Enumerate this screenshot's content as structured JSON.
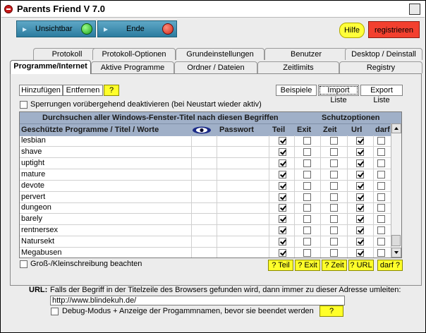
{
  "window": {
    "title": "Parents Friend V 7.0"
  },
  "topbar": {
    "unsichtbar": "Unsichtbar",
    "ende": "Ende",
    "hilfe": "Hilfe",
    "registrieren": "registrieren"
  },
  "tabs_row1": [
    "Protokoll",
    "Protokoll-Optionen",
    "Grundeinstellungen",
    "Benutzer",
    "Desktop / Deinstall"
  ],
  "tabs_row2": [
    "Programme/Internet",
    "Aktive Programme",
    "Ordner / Dateien",
    "Zeitlimits",
    "Registry"
  ],
  "toolbar": {
    "add": "Hinzufügen",
    "remove": "Entfernen",
    "help": "?",
    "examples": "Beispiele",
    "import": "Import Liste",
    "export": "Export Liste"
  },
  "deactivate_label": "Sperrungen vorübergehend deaktivieren (bei Neustart wieder aktiv)",
  "grid": {
    "header_search": "Durchsuchen aller Windows-Fenster-Titel nach diesen Begriffen",
    "header_protect": "Schutzoptionen",
    "columns": [
      "Geschützte Programme / Titel / Worte",
      "Passwort",
      "Teil",
      "Exit",
      "Zeit",
      "Url",
      "darf"
    ],
    "rows": [
      {
        "name": "lesbian",
        "teil": true,
        "exit": false,
        "zeit": false,
        "url": true,
        "darf": false
      },
      {
        "name": "shave",
        "teil": true,
        "exit": false,
        "zeit": false,
        "url": true,
        "darf": false
      },
      {
        "name": "uptight",
        "teil": true,
        "exit": false,
        "zeit": false,
        "url": true,
        "darf": false
      },
      {
        "name": "mature",
        "teil": true,
        "exit": false,
        "zeit": false,
        "url": true,
        "darf": false
      },
      {
        "name": "devote",
        "teil": true,
        "exit": false,
        "zeit": false,
        "url": true,
        "darf": false
      },
      {
        "name": "pervert",
        "teil": true,
        "exit": false,
        "zeit": false,
        "url": true,
        "darf": false
      },
      {
        "name": "dungeon",
        "teil": true,
        "exit": false,
        "zeit": false,
        "url": true,
        "darf": false
      },
      {
        "name": "barely",
        "teil": true,
        "exit": false,
        "zeit": false,
        "url": true,
        "darf": false
      },
      {
        "name": "rentnersex",
        "teil": true,
        "exit": false,
        "zeit": false,
        "url": true,
        "darf": false
      },
      {
        "name": "Natursekt",
        "teil": true,
        "exit": false,
        "zeit": false,
        "url": true,
        "darf": false
      },
      {
        "name": "Megabusen",
        "teil": true,
        "exit": false,
        "zeit": false,
        "url": true,
        "darf": false
      }
    ]
  },
  "case_label": "Groß-/Kleinschreibung beachten",
  "help_buttons": [
    "? Teil",
    "? Exit",
    "? Zeit",
    "? URL",
    "darf ?"
  ],
  "url": {
    "label": "URL:",
    "description": "Falls der Begriff in der Titelzeile des Browsers gefunden wird, dann immer zu dieser Adresse umleiten:",
    "value": "http://www.blindekuh.de/",
    "debug_label": "Debug-Modus + Anzeige der Progammnamen, bevor sie beendet werden",
    "help": "?"
  },
  "colors": {
    "accent": "#2c7c9f",
    "header": "#a0b0c8",
    "yellow": "#ffff2a",
    "red": "#f3402f"
  },
  "icons": {
    "window": "stop-icon",
    "password_header": "eye-icon"
  }
}
